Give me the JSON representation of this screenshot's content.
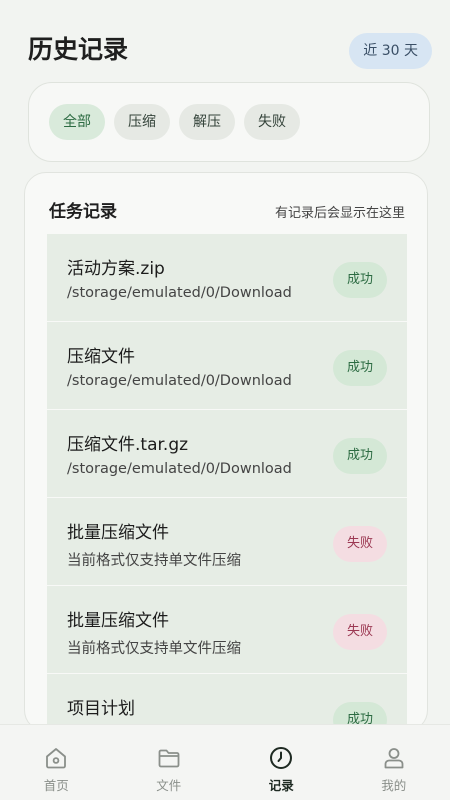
{
  "header": {
    "title": "历史记录",
    "range_label": "近 30 天"
  },
  "filters": [
    {
      "label": "全部",
      "active": true
    },
    {
      "label": "压缩",
      "active": false
    },
    {
      "label": "解压",
      "active": false
    },
    {
      "label": "失败",
      "active": false
    }
  ],
  "records": {
    "title": "任务记录",
    "hint": "有记录后会显示在这里",
    "items": [
      {
        "name": "活动方案.zip",
        "detail": "/storage/emulated/0/Download",
        "status": "成功",
        "status_type": "ok"
      },
      {
        "name": "压缩文件",
        "detail": "/storage/emulated/0/Download",
        "status": "成功",
        "status_type": "ok"
      },
      {
        "name": "压缩文件.tar.gz",
        "detail": "/storage/emulated/0/Download",
        "status": "成功",
        "status_type": "ok"
      },
      {
        "name": "批量压缩文件",
        "detail": "当前格式仅支持单文件压缩",
        "status": "失败",
        "status_type": "fail"
      },
      {
        "name": "批量压缩文件",
        "detail": "当前格式仅支持单文件压缩",
        "status": "失败",
        "status_type": "fail"
      },
      {
        "name": "项目计划",
        "detail": "",
        "status": "成功",
        "status_type": "ok"
      }
    ]
  },
  "tabbar": {
    "items": [
      {
        "label": "首页",
        "icon": "home-icon",
        "active": false
      },
      {
        "label": "文件",
        "icon": "folder-icon",
        "active": false
      },
      {
        "label": "记录",
        "icon": "clock-icon",
        "active": true
      },
      {
        "label": "我的",
        "icon": "person-icon",
        "active": false
      }
    ]
  },
  "colors": {
    "background": "#f2f4f1",
    "accent": "#2c6b42",
    "success_bg": "#d4e8d6",
    "fail_bg": "#f4dde2",
    "fail_text": "#9b3852",
    "range_chip_bg": "#d7e5f3"
  }
}
